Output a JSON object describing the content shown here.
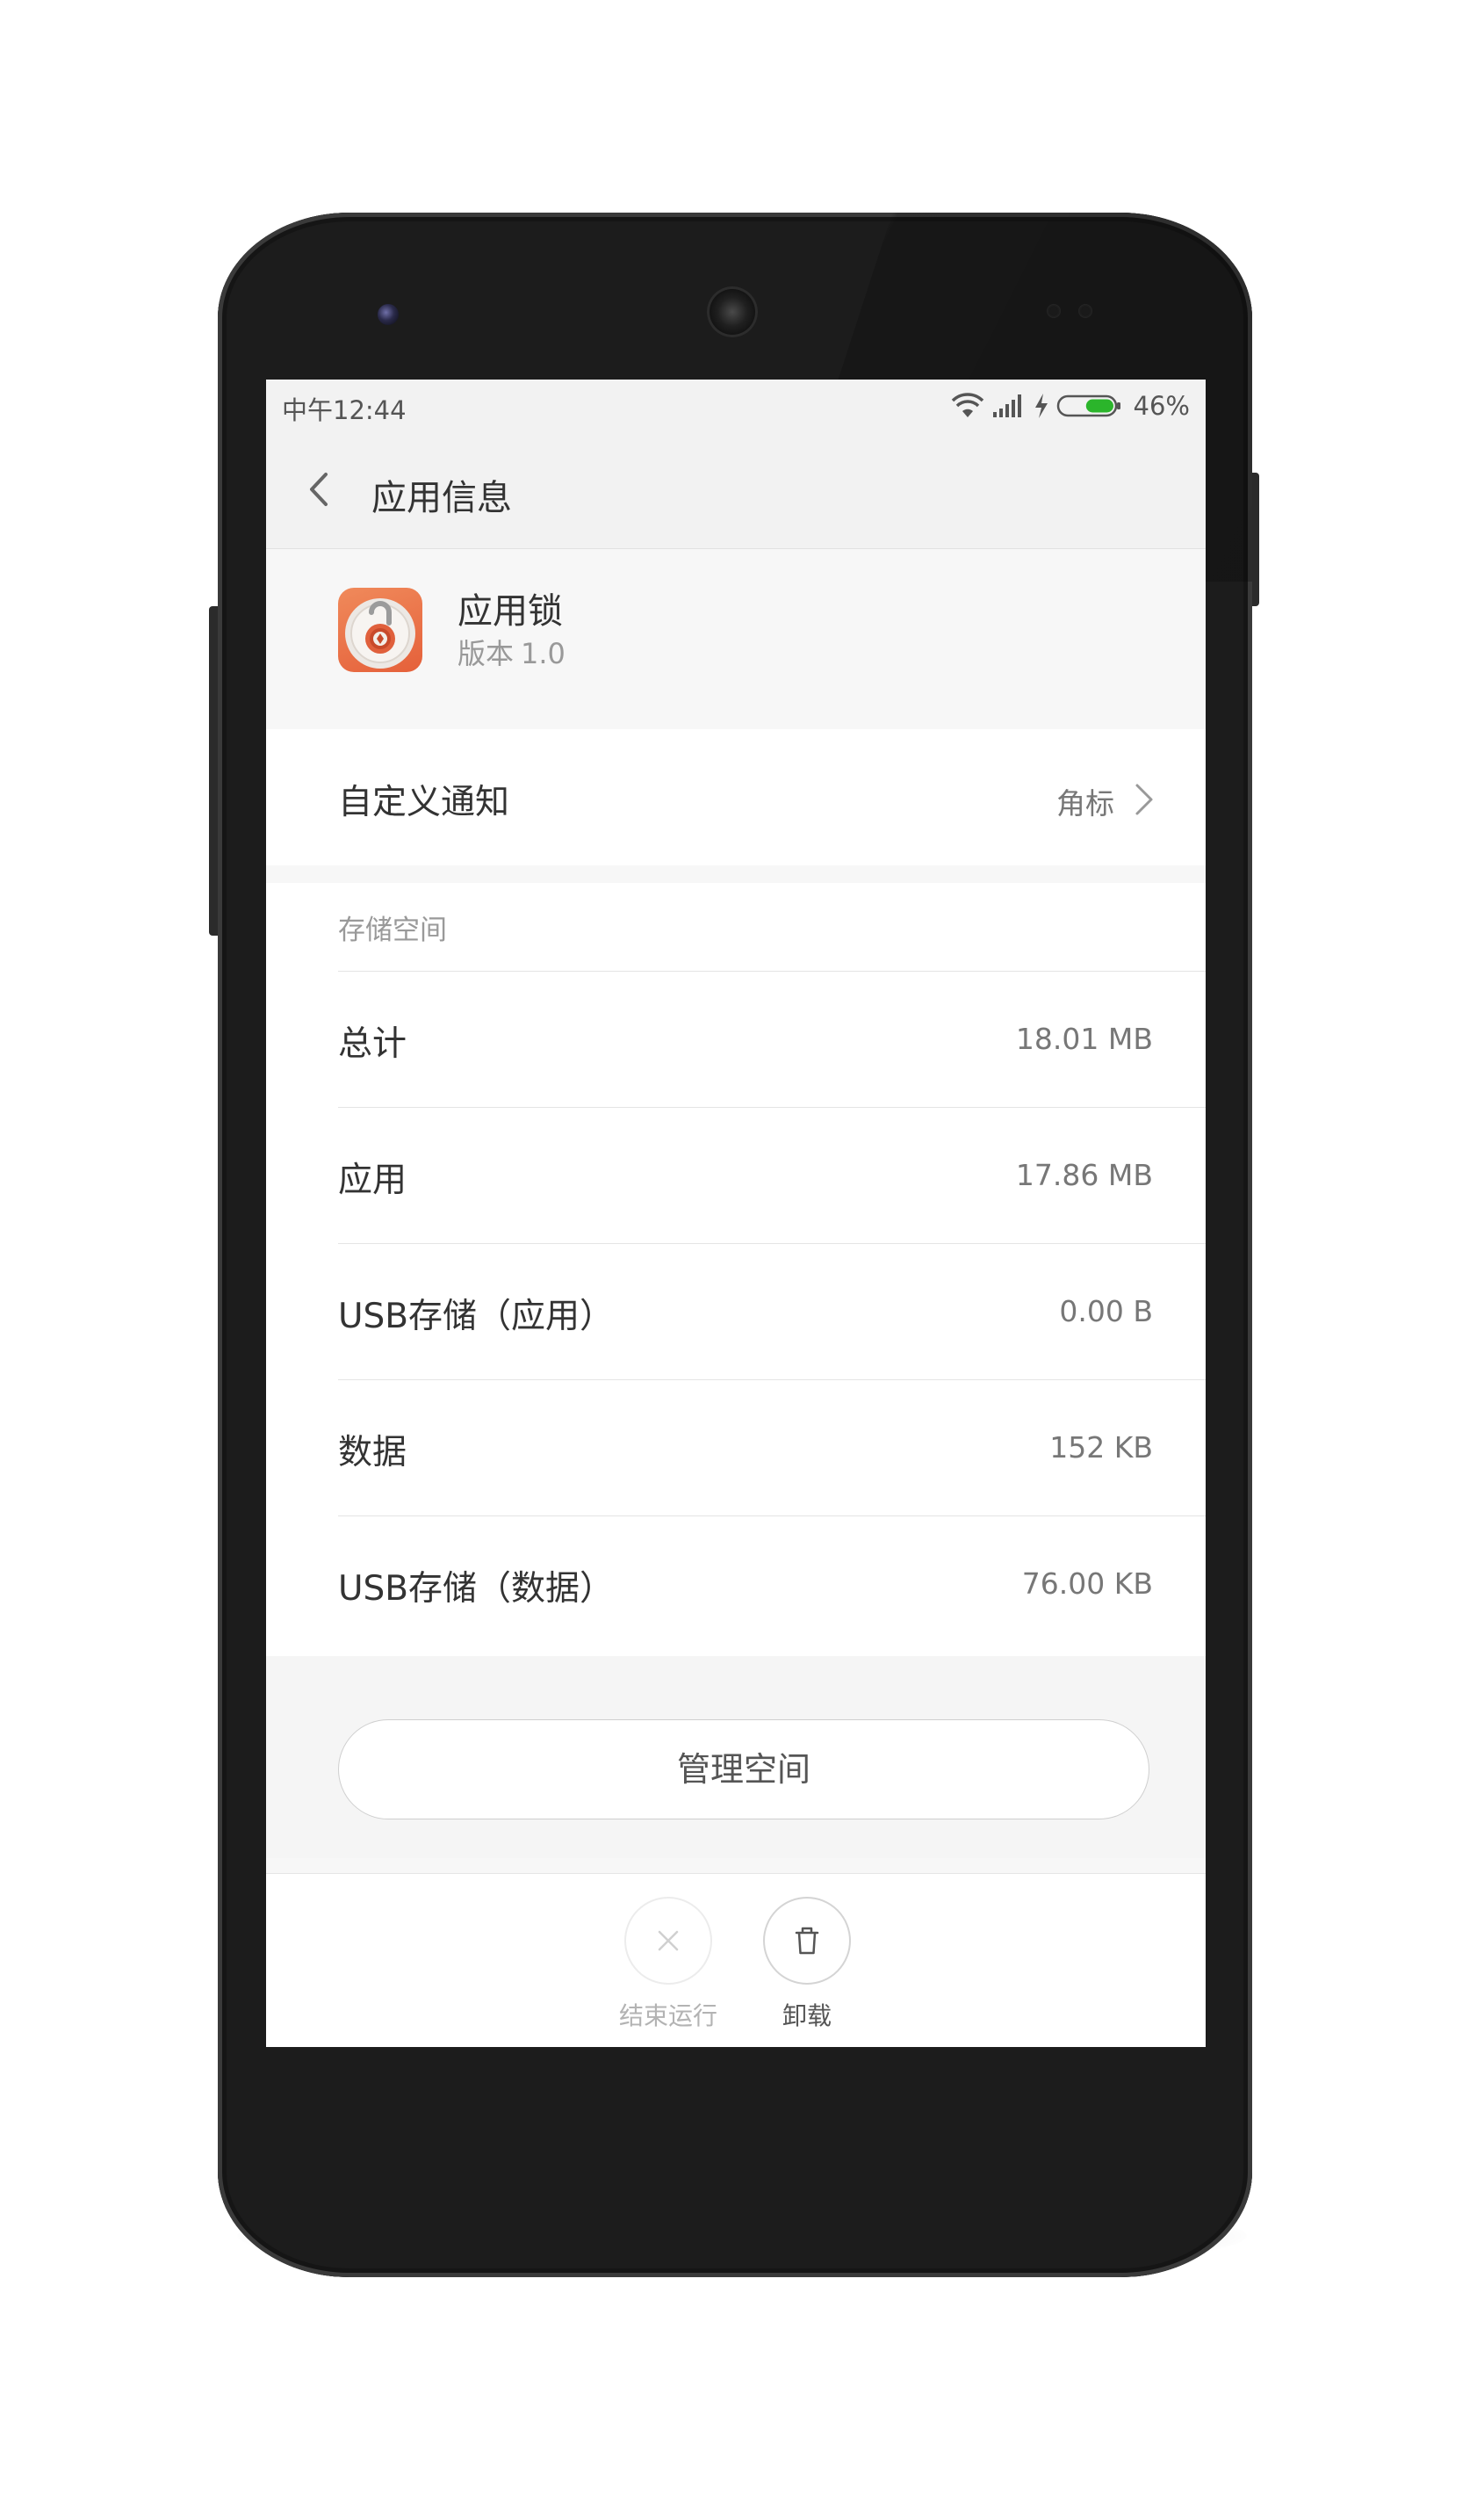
{
  "status_bar": {
    "time": "中午12:44",
    "battery_percent": "46%",
    "battery_level": 0.46,
    "charging": true
  },
  "title_bar": {
    "title": "应用信息",
    "back_icon": "chevron-left-icon"
  },
  "app": {
    "name": "应用锁",
    "version_label": "版本",
    "version_number": "1.0",
    "icon": "padlock-icon"
  },
  "notification": {
    "label": "自定义通知",
    "value": "角标"
  },
  "storage": {
    "section_title": "存储空间",
    "rows": [
      {
        "label": "总计",
        "value": "18.01 MB"
      },
      {
        "label": "应用",
        "value": "17.86 MB"
      },
      {
        "label": "USB存储（应用）",
        "value": "0.00 B"
      },
      {
        "label": "数据",
        "value": "152 KB"
      },
      {
        "label": "USB存储（数据）",
        "value": "76.00 KB"
      }
    ]
  },
  "manage_button": {
    "label": "管理空间"
  },
  "actions": {
    "force_stop": {
      "label": "结束运行",
      "icon": "close-icon",
      "enabled": false
    },
    "uninstall": {
      "label": "卸载",
      "icon": "trash-icon",
      "enabled": true
    }
  },
  "colors": {
    "battery_green": "#2bb52b",
    "accent_icon": "#e8643d"
  }
}
